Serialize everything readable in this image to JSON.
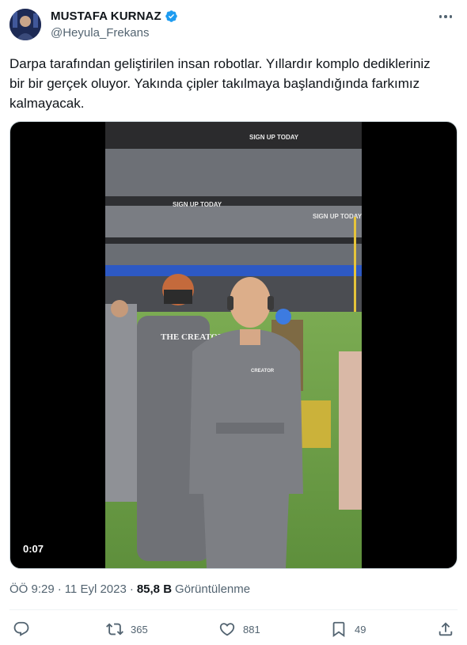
{
  "author": {
    "name": "MUSTAFA KURNAZ",
    "handle": "@Heyula_Frekans",
    "verified": true
  },
  "tweet": {
    "text": "Darpa tarafından geliştirilen insan robotlar. Yıllardır komplo dedikleriniz\nbir bir gerçek oluyor. Yakında çipler takılmaya başlandığında farkımız\nkalmayacak."
  },
  "media": {
    "type": "video",
    "duration": "0:07",
    "signs": [
      "SIGN UP TODAY",
      "SIGN UP TODAY",
      "SIGN UP TODAY"
    ],
    "uniform_text": "THE CREATOR",
    "badge_text": "CREATOR"
  },
  "meta": {
    "time": "ÖÖ 9:29",
    "separator": "·",
    "date": "11 Eyl 2023",
    "views": "85,8 B",
    "views_label": "Görüntülenme"
  },
  "actions": {
    "reply": {
      "icon": "reply-icon",
      "count": ""
    },
    "retweet": {
      "icon": "retweet-icon",
      "count": "365"
    },
    "like": {
      "icon": "heart-icon",
      "count": "881"
    },
    "bookmark": {
      "icon": "bookmark-icon",
      "count": "49"
    },
    "share": {
      "icon": "share-icon",
      "count": ""
    }
  },
  "colors": {
    "verified": "#1d9bf0",
    "text": "#0f1419",
    "secondary": "#536471",
    "field_green": "#6fa34a",
    "stands_blue": "#2d59c4"
  }
}
